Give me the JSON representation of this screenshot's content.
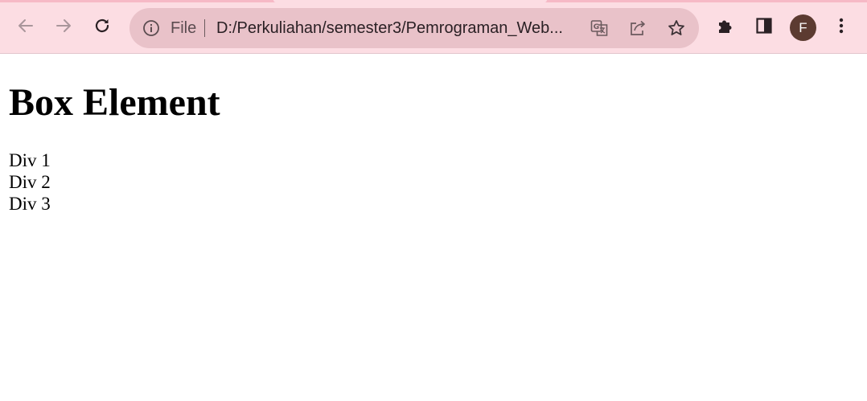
{
  "browser": {
    "address_bar": {
      "scheme_label": "File",
      "url": "D:/Perkuliahan/semester3/Pemrograman_Web..."
    },
    "profile_initial": "F",
    "icons": [
      "back-arrow-icon",
      "forward-arrow-icon",
      "reload-icon",
      "info-icon",
      "translate-icon",
      "share-icon",
      "star-icon",
      "extensions-puzzle-icon",
      "side-panel-icon",
      "more-vert-icon"
    ],
    "colors": {
      "toolbar_bg": "#fcdde3",
      "omnibox_bg": "#e9c2c9",
      "avatar_bg": "#5c3b31"
    }
  },
  "page": {
    "heading": "Box Element",
    "divs": [
      "Div 1",
      "Div 2",
      "Div 3"
    ]
  }
}
